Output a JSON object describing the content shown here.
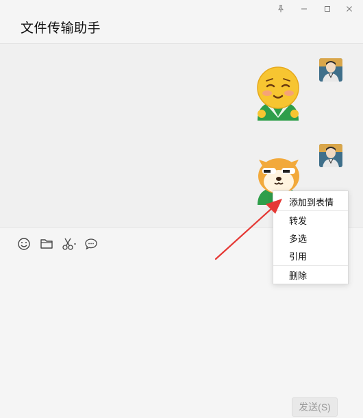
{
  "window": {
    "title": "文件传输助手",
    "controls": [
      "pin-icon",
      "minimize-icon",
      "maximize-icon",
      "close-icon"
    ]
  },
  "messages": [
    {
      "type": "sticker",
      "sticker": "shy-smile-emoji",
      "from": "self"
    },
    {
      "type": "sticker",
      "sticker": "shiba-dog-sticker",
      "from": "self"
    }
  ],
  "toolbar": {
    "icons": [
      "emoji-icon",
      "folder-icon",
      "scissors-icon",
      "chat-history-icon"
    ]
  },
  "context_menu": {
    "items": [
      {
        "label": "添加到表情"
      },
      {
        "label": "转发"
      },
      {
        "label": "多选"
      },
      {
        "label": "引用"
      },
      {
        "label": "删除"
      }
    ]
  },
  "send_button": {
    "label": "发送(S)"
  },
  "colors": {
    "annotation_arrow": "#e53935",
    "accent_green": "#2e9e4a",
    "emoji_yellow": "#f7c531"
  }
}
